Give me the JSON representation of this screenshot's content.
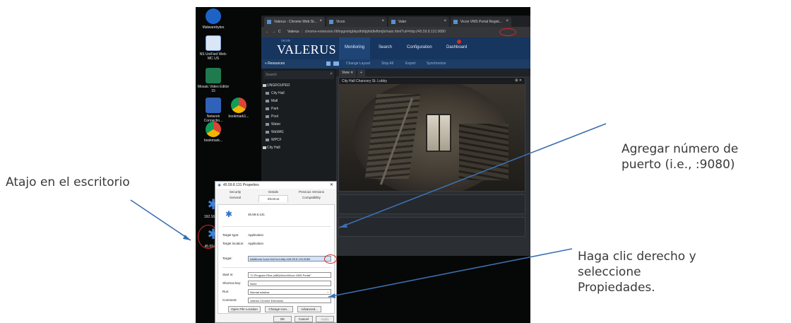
{
  "annotations": {
    "left": "Atajo en el escritorio",
    "port_line1": "Agregar número de",
    "port_line2": "puerto (i.e., :9080)",
    "right_line1": "Haga clic derecho y",
    "right_line2": "seleccione",
    "right_line3": "Propiedades."
  },
  "colors": {
    "annotation_text": "#3a3a3a",
    "arrow": "#3b6fb0",
    "highlight_circle": "#d42a2a",
    "valerus_blue": "#16355f"
  },
  "desktop": {
    "icons": [
      {
        "label": "Malwarebytes",
        "icon": "malwarebytes-icon"
      },
      {
        "label": "NS UniFied Web-MC US",
        "icon": "app-icon"
      },
      {
        "label": "Mosaic Video Editor 15",
        "icon": "editor-icon"
      },
      {
        "label": "Network Connectio...",
        "icon": "network-icon"
      },
      {
        "label": "bookmark1...",
        "icon": "chrome-icon"
      },
      {
        "label": "bookmark...",
        "icon": "chrome-icon"
      },
      {
        "label": "192.168.1...",
        "icon": "vms-shortcut-icon"
      },
      {
        "label": "45.59.8.1...",
        "icon": "vms-shortcut-icon"
      }
    ]
  },
  "browser": {
    "tabs": [
      {
        "label": "Valerus - Chrome Web St..."
      },
      {
        "label": "Vicon"
      },
      {
        "label": "Valer"
      },
      {
        "label": "Vicon VMS Portal Regist..."
      }
    ],
    "address": {
      "site": "Valerus",
      "url": "chrome-extension://bfnpgmidgbkpdhbfpjhddlefbmjb/main.html?url=http://45.59.8.131:9080"
    }
  },
  "valerus": {
    "brand_small": "VICON",
    "brand": "VALERUS",
    "nav": [
      "Monitoring",
      "Search",
      "Configuration",
      "Dashboard"
    ],
    "toolbar": {
      "resources": "Resources",
      "actions": [
        "Change Layout",
        "Stop All",
        "Export",
        "Synchronize"
      ]
    },
    "search_placeholder": "Search",
    "tree": [
      {
        "label": "UNGROUPED",
        "group": true
      },
      {
        "label": "City Hall",
        "group": false
      },
      {
        "label": "Mall",
        "group": false
      },
      {
        "label": "Park",
        "group": false
      },
      {
        "label": "Pool",
        "group": false
      },
      {
        "label": "Water",
        "group": false
      },
      {
        "label": "WaWA1",
        "group": false
      },
      {
        "label": "WPCF",
        "group": false
      },
      {
        "label": "City Hall",
        "group": true
      }
    ],
    "view_tab": "View",
    "camera_title": "City Hall Chancery St. Lobby",
    "camera_controls": "⊞  ✕"
  },
  "dialog": {
    "title": "45.59.8.131 Properties",
    "tabs_top": [
      "Security",
      "Details",
      "Previous Versions"
    ],
    "tabs_bottom": [
      "General",
      "Shortcut",
      "Compatibility"
    ],
    "name": "45.59.8.131",
    "target_type_label": "Target type:",
    "target_type": "Application",
    "target_location_label": "Target location:",
    "target_location": "Application",
    "target_label": "Target:",
    "target_value": "lxtid8onm huon.htm?url=http://45.59.8.131:9080",
    "start_in_label": "Start in:",
    "start_in": "\"C:\\Program Files (x86)\\Vicon\\Vicon VMS Portal\"",
    "shortcut_key_label": "Shortcut key:",
    "shortcut_key": "None",
    "run_label": "Run:",
    "run": "Normal window",
    "comment_label": "Comment:",
    "comment": "Valerus Chrome Extension",
    "btn_open": "Open File Location",
    "btn_change_icon": "Change Icon...",
    "btn_advanced": "Advanced...",
    "btn_ok": "OK",
    "btn_cancel": "Cancel",
    "btn_apply": "Apply"
  }
}
